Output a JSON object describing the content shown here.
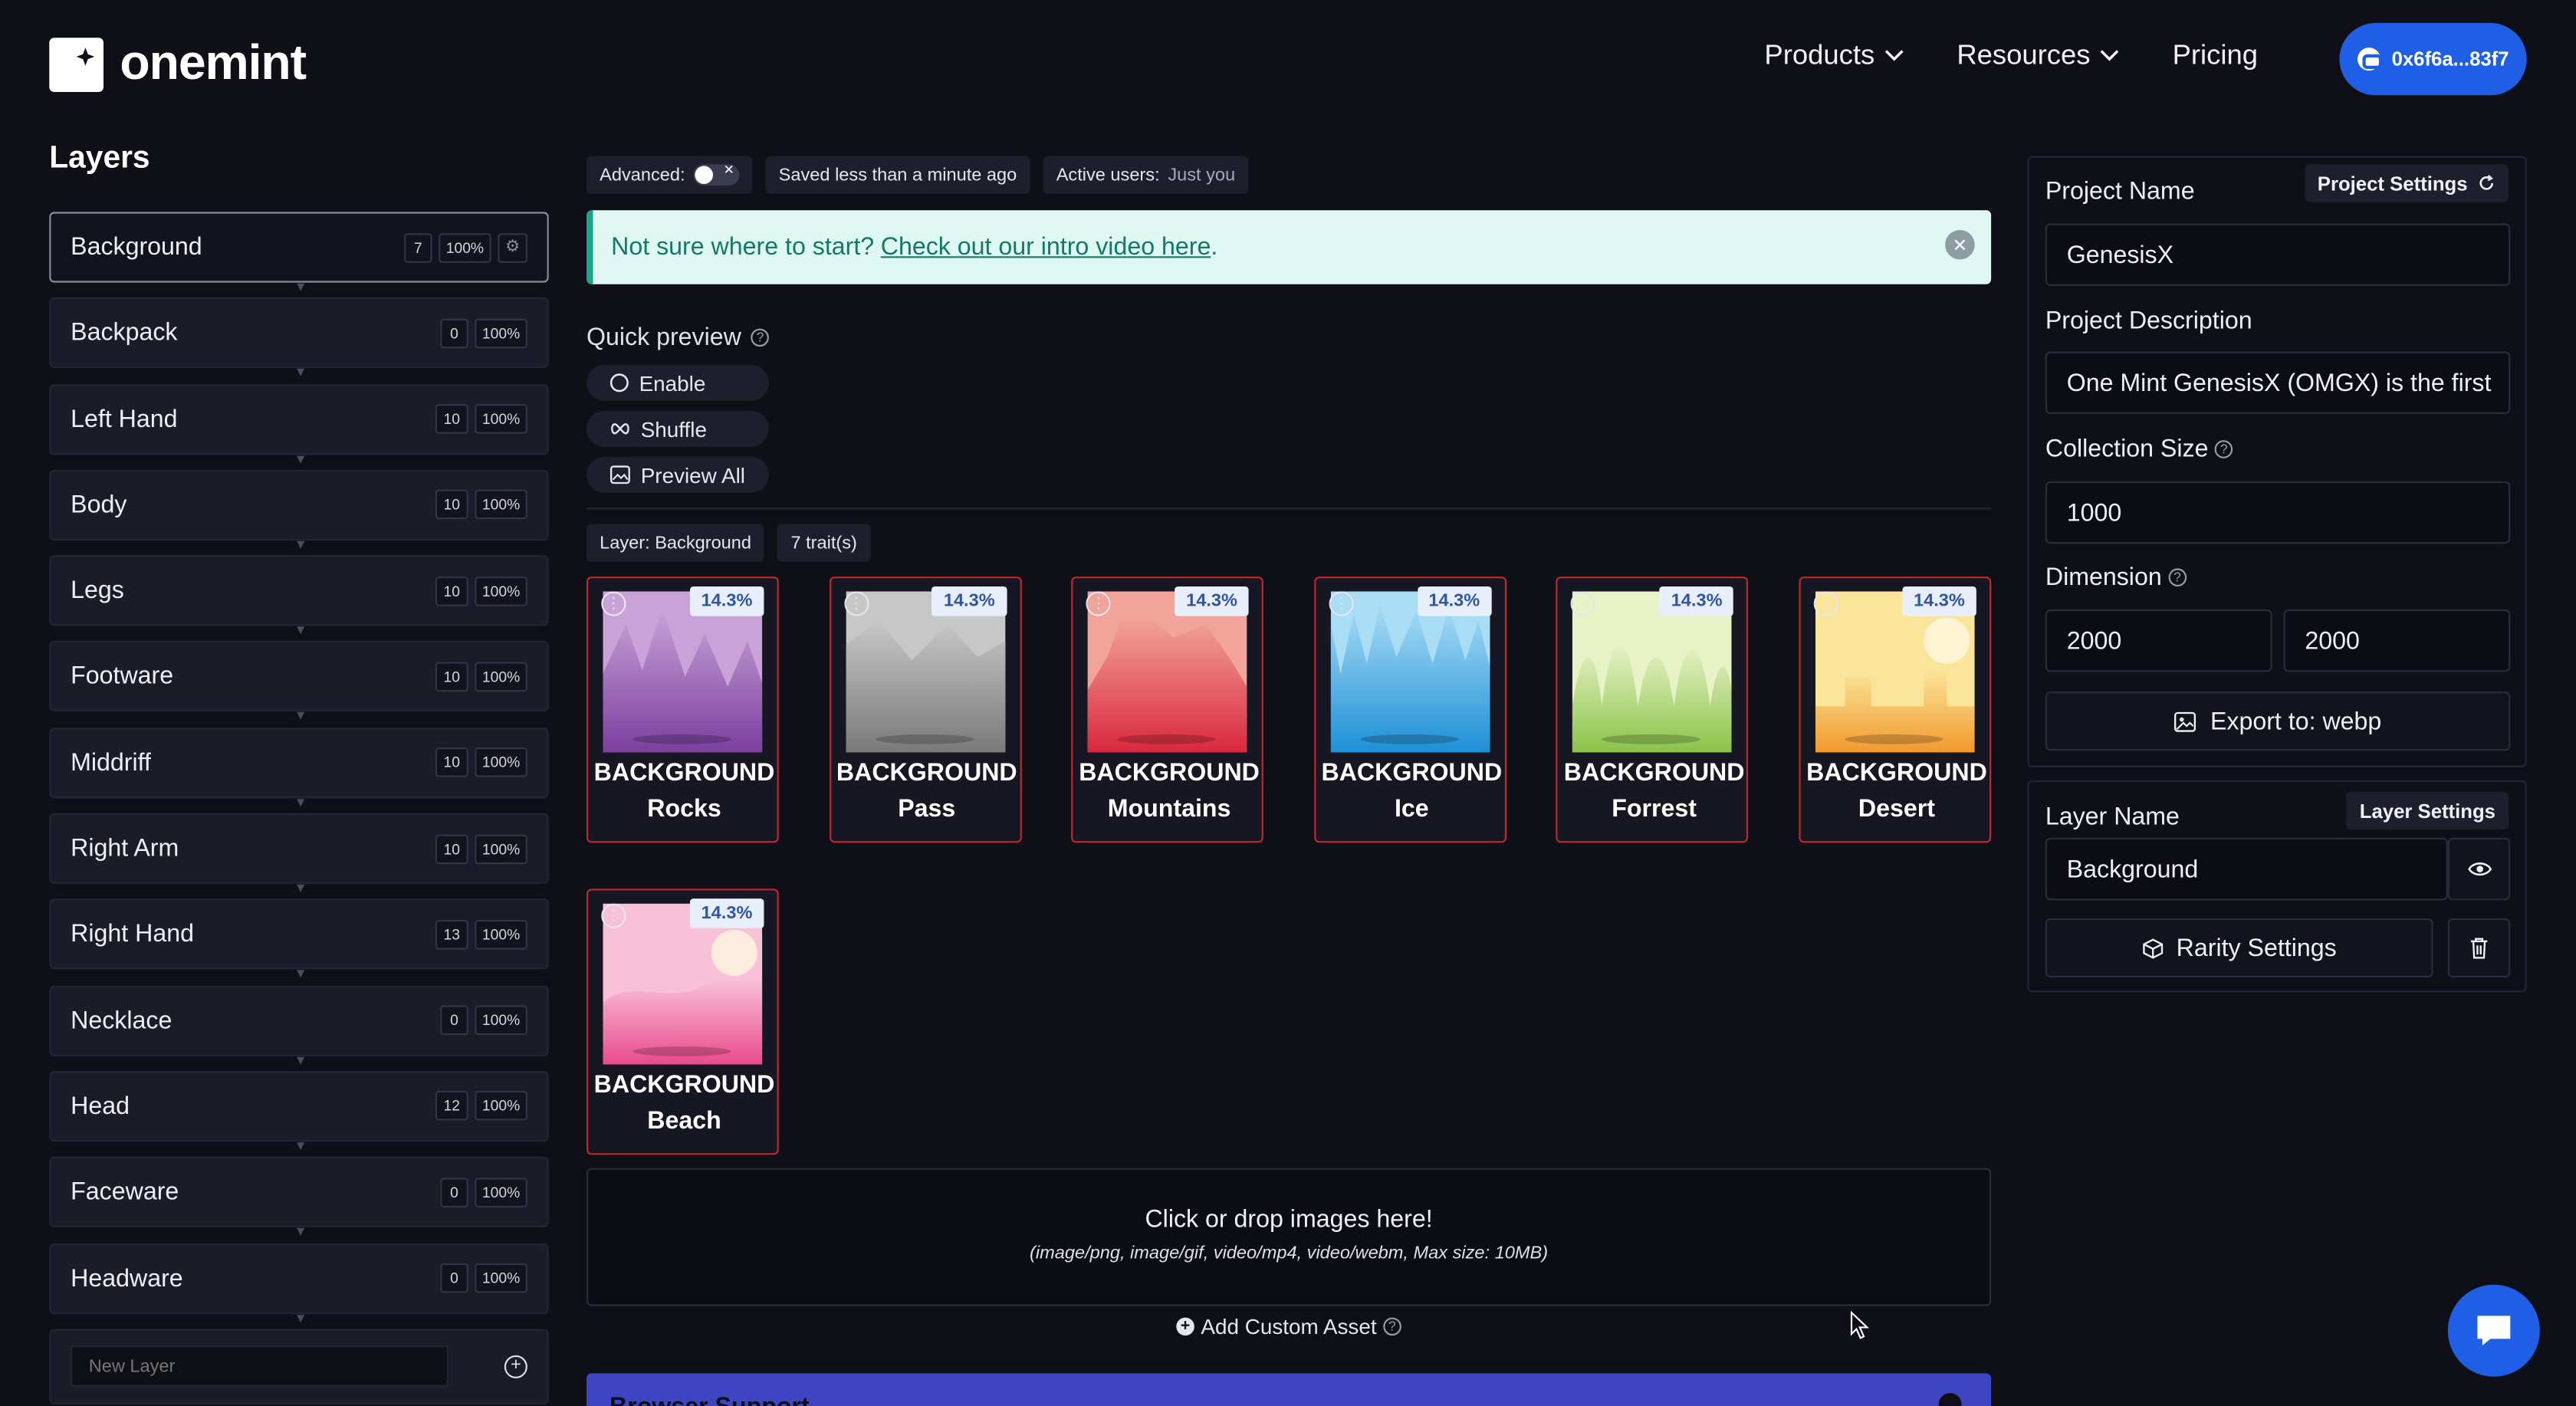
{
  "header": {
    "logo_text": "onemint",
    "nav": [
      {
        "label": "Products",
        "has_dropdown": true
      },
      {
        "label": "Resources",
        "has_dropdown": true
      },
      {
        "label": "Pricing",
        "has_dropdown": false
      }
    ],
    "wallet": "0x6f6a...83f7"
  },
  "sidebar": {
    "title": "Layers",
    "layers": [
      {
        "name": "Background",
        "count": "7",
        "pct": "100%",
        "active": true
      },
      {
        "name": "Backpack",
        "count": "0",
        "pct": "100%"
      },
      {
        "name": "Left Hand",
        "count": "10",
        "pct": "100%"
      },
      {
        "name": "Body",
        "count": "10",
        "pct": "100%"
      },
      {
        "name": "Legs",
        "count": "10",
        "pct": "100%"
      },
      {
        "name": "Footware",
        "count": "10",
        "pct": "100%"
      },
      {
        "name": "Middriff",
        "count": "10",
        "pct": "100%"
      },
      {
        "name": "Right Arm",
        "count": "10",
        "pct": "100%"
      },
      {
        "name": "Right Hand",
        "count": "13",
        "pct": "100%"
      },
      {
        "name": "Necklace",
        "count": "0",
        "pct": "100%"
      },
      {
        "name": "Head",
        "count": "12",
        "pct": "100%"
      },
      {
        "name": "Faceware",
        "count": "0",
        "pct": "100%"
      },
      {
        "name": "Headware",
        "count": "0",
        "pct": "100%"
      }
    ],
    "new_layer_placeholder": "New Layer"
  },
  "toolbar": {
    "advanced_label": "Advanced:",
    "saved": "Saved less than a minute ago",
    "active_users_label": "Active users:",
    "active_users_value": "Just you"
  },
  "banner": {
    "text": "Not sure where to start?",
    "link": "Check out our intro video here",
    "suffix": "."
  },
  "quick_preview": {
    "title": "Quick preview",
    "buttons": [
      "Enable",
      "Shuffle",
      "Preview All"
    ]
  },
  "layer_info": {
    "layer": "Layer: Background",
    "traits": "7 trait(s)"
  },
  "traits": [
    {
      "category": "BACKGROUND",
      "name": "Rocks",
      "pct": "14.3%",
      "colors": [
        "#c9a3d8",
        "#7b3f9e"
      ]
    },
    {
      "category": "BACKGROUND",
      "name": "Pass",
      "pct": "14.3%",
      "colors": [
        "#c7c7c7",
        "#7a7a7a"
      ]
    },
    {
      "category": "BACKGROUND",
      "name": "Mountains",
      "pct": "14.3%",
      "colors": [
        "#f2a49a",
        "#d9283d"
      ]
    },
    {
      "category": "BACKGROUND",
      "name": "Ice",
      "pct": "14.3%",
      "colors": [
        "#a9dcf5",
        "#1e90d6"
      ]
    },
    {
      "category": "BACKGROUND",
      "name": "Forrest",
      "pct": "14.3%",
      "colors": [
        "#e7f2c6",
        "#8bc34a"
      ]
    },
    {
      "category": "BACKGROUND",
      "name": "Desert",
      "pct": "14.3%",
      "colors": [
        "#fbe59a",
        "#f29a2e"
      ]
    },
    {
      "category": "BACKGROUND",
      "name": "Beach",
      "pct": "14.3%",
      "colors": [
        "#f9c1d8",
        "#e94b8c"
      ]
    }
  ],
  "dropzone": {
    "title": "Click or drop images here!",
    "subtitle": "(image/png, image/gif, video/mp4, video/webm, Max size: 10MB)"
  },
  "custom_asset": "Add Custom Asset",
  "browser_banner": "Browser Support",
  "project": {
    "settings_label": "Project Settings",
    "name_label": "Project Name",
    "name_value": "GenesisX",
    "desc_label": "Project Description",
    "desc_value": "One Mint GenesisX (OMGX) is the first",
    "size_label": "Collection Size",
    "size_value": "1000",
    "dim_label": "Dimension",
    "dim_w": "2000",
    "dim_h": "2000",
    "export_label": "Export to: webp"
  },
  "layer_settings": {
    "settings_label": "Layer Settings",
    "name_label": "Layer Name",
    "name_value": "Background",
    "rarity_label": "Rarity Settings"
  },
  "colors": {
    "accent": "#1f5fe6",
    "trait_border": "#c1282d",
    "banner_bg": "#dff8f2",
    "browser_banner": "#3d45c2"
  }
}
